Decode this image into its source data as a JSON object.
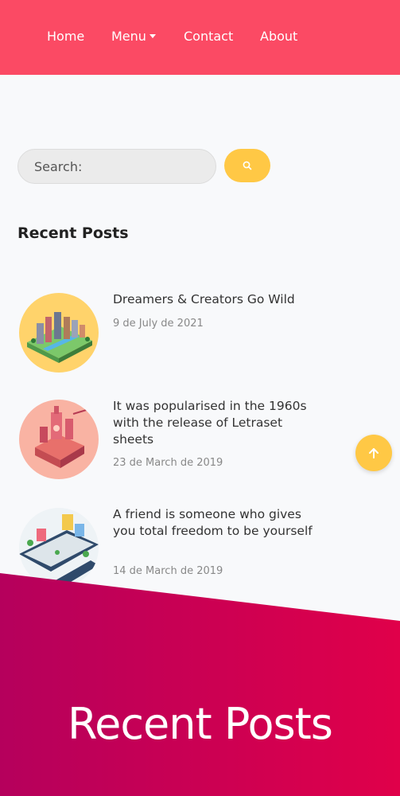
{
  "nav": {
    "items": [
      "Home",
      "Menu",
      "Contact",
      "About"
    ]
  },
  "search": {
    "placeholder": "Search:"
  },
  "section_title": "Recent Posts",
  "posts": [
    {
      "title": "Dreamers & Creators Go Wild",
      "date": "9 de July de 2021"
    },
    {
      "title": "It was popularised in the 1960s with the release of Letraset sheets",
      "date": "23 de March de 2019"
    },
    {
      "title": "A friend is someone who gives you total freedom to be yourself",
      "date": "14 de March de 2019"
    }
  ],
  "banner": {
    "title": "Recent Posts"
  },
  "colors": {
    "nav_bg": "#fb4a64",
    "accent_yellow": "#ffc845",
    "banner_start": "#b5005c",
    "banner_end": "#e0004a"
  },
  "icons": [
    "search-icon",
    "arrow-up-icon",
    "caret-down-icon"
  ]
}
